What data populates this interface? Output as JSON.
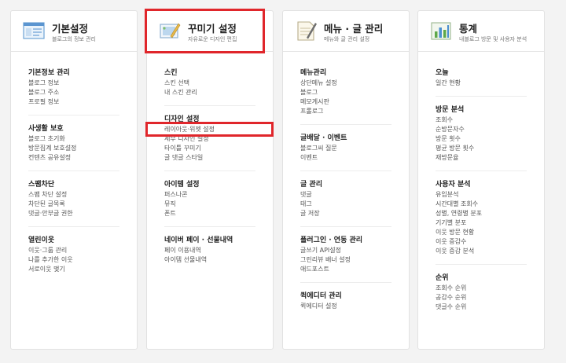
{
  "columns": [
    {
      "title": "기본설정",
      "subtitle": "블로그의 정보 관리",
      "icon": "browser-window-icon",
      "groups": [
        {
          "title": "기본정보 관리",
          "items": [
            "블로그 정보",
            "블로그 주소",
            "프로필 정보"
          ]
        },
        {
          "title": "사생활 보호",
          "items": [
            "블로그 초기화",
            "방문집계 보호설정",
            "컨텐츠 공유설정"
          ]
        },
        {
          "title": "스팸차단",
          "items": [
            "스팸 차단 설정",
            "차단된 글목록",
            "댓글·안부글 권한"
          ]
        },
        {
          "title": "열린이웃",
          "items": [
            "이웃·그룹 관리",
            "나를 추가한 이웃",
            "서로이웃 맺기"
          ]
        }
      ]
    },
    {
      "title": "꾸미기 설정",
      "subtitle": "자유로운 디자인 편집",
      "icon": "design-palette-icon",
      "groups": [
        {
          "title": "스킨",
          "items": [
            "스킨 선택",
            "내 스킨 관리"
          ]
        },
        {
          "title": "디자인 설정",
          "items": [
            "레이아웃·위젯 설정",
            "세부 디자인 설정",
            "타이틀 꾸미기",
            "글 댓글 스타일"
          ]
        },
        {
          "title": "아이템 설정",
          "items": [
            "퍼스나콘",
            "뮤직",
            "폰트"
          ]
        },
        {
          "title": "네이버 페이 · 선물내역",
          "items": [
            "페이 이용내역",
            "아이템 선물내역"
          ]
        }
      ]
    },
    {
      "title": "메뉴 · 글 관리",
      "subtitle": "메뉴와 글 관리 설정",
      "icon": "document-pen-icon",
      "groups": [
        {
          "title": "메뉴관리",
          "items": [
            "상단메뉴 설정",
            "블로그",
            "메모게시판",
            "프롤로그"
          ]
        },
        {
          "title": "글배달 · 이벤트",
          "items": [
            "블로그씨 질문",
            "이벤트"
          ]
        },
        {
          "title": "글 관리",
          "items": [
            "댓글",
            "태그",
            "글 저장"
          ]
        },
        {
          "title": "플러그인 · 연동 관리",
          "items": [
            "글쓰기 API설정",
            "그린리뷰 배너 설정",
            "애드포스트"
          ]
        },
        {
          "title": "퀵에디터 관리",
          "items": [
            "퀵에디터 설정"
          ]
        }
      ]
    },
    {
      "title": "통계",
      "subtitle": "내블로그 방문 및 사용자 분석",
      "icon": "bar-chart-icon",
      "groups": [
        {
          "title": "오늘",
          "items": [
            "일간 현황"
          ]
        },
        {
          "title": "방문 분석",
          "items": [
            "조회수",
            "순방문자수",
            "방문 횟수",
            "평균 방문 횟수",
            "재방문율"
          ]
        },
        {
          "title": "사용자 분석",
          "items": [
            "유입분석",
            "시간대별 조회수",
            "성별, 연령별 분포",
            "기기별 분포",
            "이웃 방문 현황",
            "이웃 증감수",
            "이웃 증감 분석"
          ]
        },
        {
          "title": "순위",
          "items": [
            "조회수 순위",
            "공감수 순위",
            "댓글수 순위"
          ]
        }
      ]
    }
  ]
}
